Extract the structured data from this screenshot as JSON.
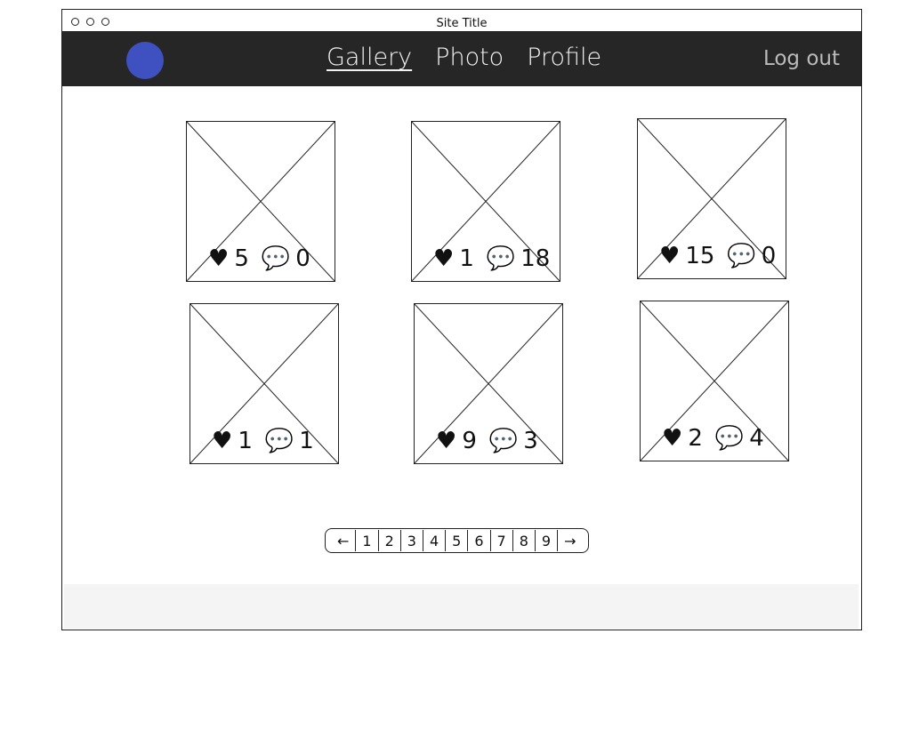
{
  "window": {
    "title": "Site Title"
  },
  "nav": {
    "links": [
      {
        "label": "Gallery",
        "active": true
      },
      {
        "label": "Photo",
        "active": false
      },
      {
        "label": "Profile",
        "active": false
      }
    ],
    "logout": "Log out",
    "logo_color": "#3f51c0",
    "bar_color": "#262626"
  },
  "photos": [
    {
      "likes": "5",
      "comments": "0"
    },
    {
      "likes": "1",
      "comments": "18"
    },
    {
      "likes": "15",
      "comments": "0"
    },
    {
      "likes": "1",
      "comments": "1"
    },
    {
      "likes": "9",
      "comments": "3"
    },
    {
      "likes": "2",
      "comments": "4"
    }
  ],
  "pagination": {
    "prev": "←",
    "pages": [
      "1",
      "2",
      "3",
      "4",
      "5",
      "6",
      "7",
      "8",
      "9"
    ],
    "next": "→"
  }
}
